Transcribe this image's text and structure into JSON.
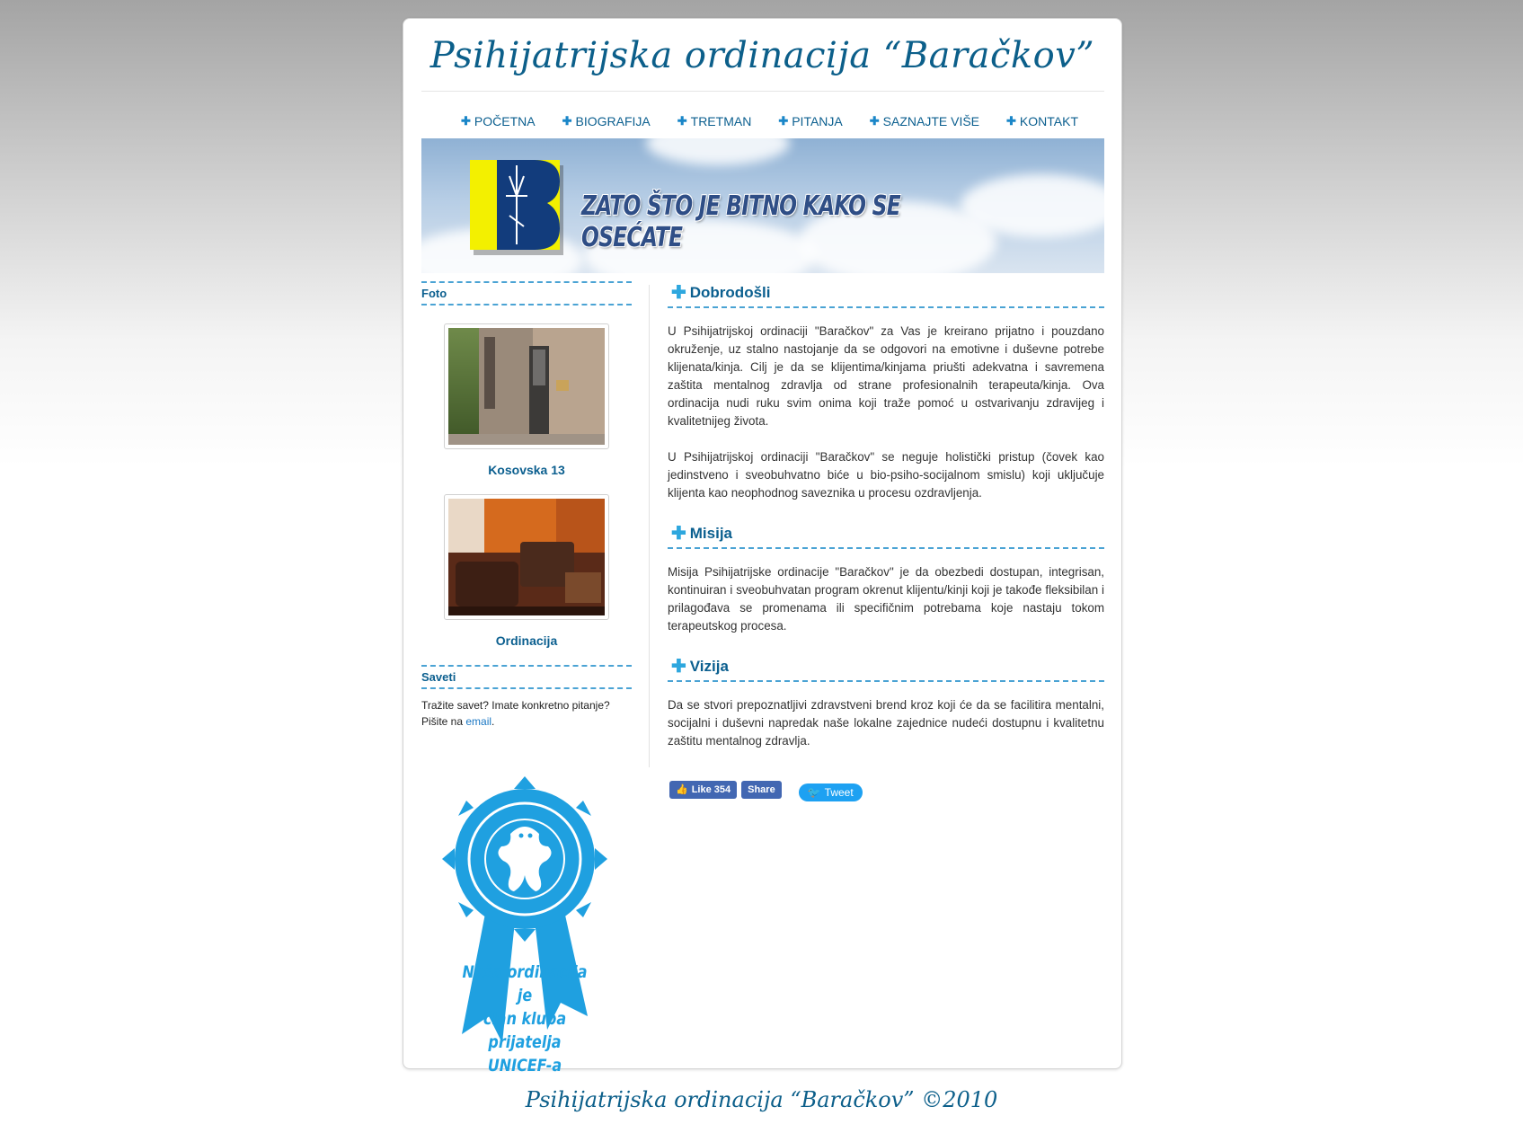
{
  "header": {
    "title": "Psihijatrijska ordinacija “Baračkov”"
  },
  "nav": [
    {
      "label": "POČETNA"
    },
    {
      "label": "BIOGRAFIJA"
    },
    {
      "label": "TRETMAN"
    },
    {
      "label": "PITANJA"
    },
    {
      "label": "SAZNAJTE VIŠE"
    },
    {
      "label": "KONTAKT"
    }
  ],
  "banner": {
    "slogan": "ZATO ŠTO JE BITNO KAKO SE OSEĆATE"
  },
  "sidebar": {
    "foto_heading": "Foto",
    "photos": [
      {
        "caption": "Kosovska 13"
      },
      {
        "caption": "Ordinacija"
      }
    ],
    "saveti_heading": "Saveti",
    "saveti_text": "Tražite savet? Imate konkretno pitanje? Pišite na ",
    "email_link": "email",
    "saveti_end": ".",
    "unicef_badge_text": "UNICEF KLUB PRIJATELJA",
    "unicef_line1": "Naša ordinacija je",
    "unicef_line2": "član kluba prijatelja",
    "unicef_line3": "UNICEF-a"
  },
  "content": {
    "sections": [
      {
        "heading": "Dobrodošli",
        "paragraphs": [
          "U Psihijatrijskoj ordinaciji \"Baračkov\" za Vas je kreirano prijatno i pouzdano okruženje, uz stalno nastojanje da se odgovori na emotivne i duševne potrebe klijenata/kinja. Cilj je da se klijentima/kinjama priušti adekvatna i savremena zaštita mentalnog zdravlja od strane profesionalnih terapeuta/kinja. Ova ordinacija nudi ruku svim onima koji traže pomoć u ostvarivanju zdravijeg i kvalitetnijeg života.",
          "U Psihijatrijskoj ordinaciji \"Baračkov\" se neguje holistički pristup (čovek kao jedinstveno i sveobuhvatno biće u bio-psiho-socijalnom smislu) koji uključuje klijenta kao neophodnog saveznika u procesu ozdravljenja."
        ]
      },
      {
        "heading": "Misija",
        "paragraphs": [
          "Misija Psihijatrijske ordinacije \"Baračkov\" je da obezbedi dostupan, integrisan, kontinuiran i sveobuhvatan program okrenut klijentu/kinji koji je takođe fleksibilan i prilagođava se promenama ili specifičnim potrebama koje nastaju tokom terapeutskog procesa."
        ]
      },
      {
        "heading": "Vizija",
        "paragraphs": [
          "Da se stvori prepoznatljivi zdravstveni brend kroz koji će da se facilitira mentalni, socijalni i duševni napredak naše lokalne zajednice nudeći dostupnu i kvalitetnu zaštitu mentalnog zdravlja."
        ]
      }
    ]
  },
  "social": {
    "like_label": "Like 354",
    "share_label": "Share",
    "tweet_label": "Tweet"
  },
  "footer": {
    "text": "Psihijatrijska ordinacija “Baračkov”  ©2010"
  }
}
